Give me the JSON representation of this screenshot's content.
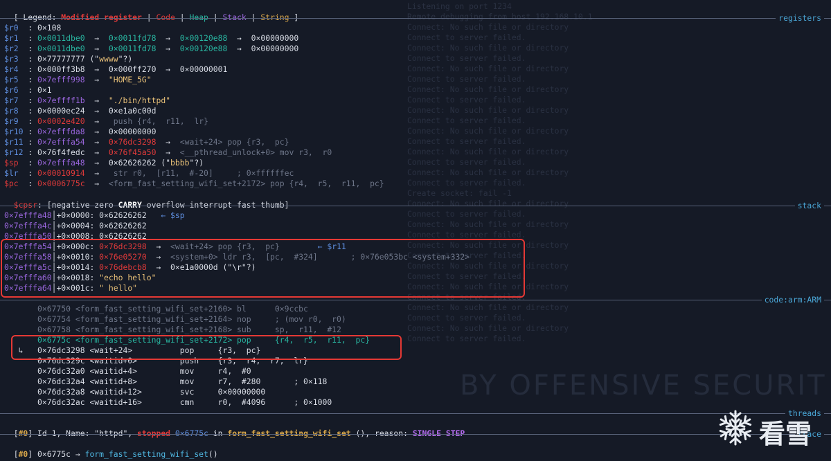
{
  "legend": {
    "prefix": "[ Legend: ",
    "modified": "Modified register",
    "sep1": " | ",
    "code": "Code",
    "sep2": " | ",
    "heap": "Heap",
    "sep3": " | ",
    "stack": "Stack",
    "sep4": " | ",
    "string": "String",
    "suffix": " ]"
  },
  "sections": {
    "registers": "registers",
    "stack": "stack",
    "code": "code:arm:ARM",
    "threads": "threads",
    "trace": "trace"
  },
  "registers": [
    {
      "name": "$r0  ",
      "colon": ": ",
      "v1": "0×108",
      "c1": "wht",
      "rest": []
    },
    {
      "name": "$r1  ",
      "colon": ": ",
      "v1": "0×0011dbe0",
      "c1": "grn",
      "rest": [
        {
          "t": "  →  ",
          "c": "wht"
        },
        {
          "t": "0×0011fd78",
          "c": "grn"
        },
        {
          "t": "  →  ",
          "c": "wht"
        },
        {
          "t": "0×00120e88",
          "c": "grn"
        },
        {
          "t": "  →  ",
          "c": "wht"
        },
        {
          "t": "0×00000000",
          "c": "wht"
        }
      ]
    },
    {
      "name": "$r2  ",
      "colon": ": ",
      "v1": "0×0011dbe0",
      "c1": "grn",
      "rest": [
        {
          "t": "  →  ",
          "c": "wht"
        },
        {
          "t": "0×0011fd78",
          "c": "grn"
        },
        {
          "t": "  →  ",
          "c": "wht"
        },
        {
          "t": "0×00120e88",
          "c": "grn"
        },
        {
          "t": "  →  ",
          "c": "wht"
        },
        {
          "t": "0×00000000",
          "c": "wht"
        }
      ]
    },
    {
      "name": "$r3  ",
      "colon": ": ",
      "v1": "0×77777777",
      "c1": "wht",
      "rest": [
        {
          "t": " (\"",
          "c": "wht"
        },
        {
          "t": "wwww",
          "c": "yel"
        },
        {
          "t": "\"?)",
          "c": "wht"
        }
      ]
    },
    {
      "name": "$r4  ",
      "colon": ": ",
      "v1": "0×000ff3b8",
      "c1": "wht",
      "rest": [
        {
          "t": "  →  ",
          "c": "wht"
        },
        {
          "t": "0×000ff270",
          "c": "wht"
        },
        {
          "t": "  →  ",
          "c": "wht"
        },
        {
          "t": "0×00000001",
          "c": "wht"
        }
      ]
    },
    {
      "name": "$r5  ",
      "colon": ": ",
      "v1": "0×7efff998",
      "c1": "pur",
      "rest": [
        {
          "t": "  →  ",
          "c": "wht"
        },
        {
          "t": "\"HOME_5G\"",
          "c": "yel"
        }
      ]
    },
    {
      "name": "$r6  ",
      "colon": ": ",
      "v1": "0×1",
      "c1": "wht",
      "rest": []
    },
    {
      "name": "$r7  ",
      "colon": ": ",
      "v1": "0×7effff1b",
      "c1": "pur",
      "rest": [
        {
          "t": "  →  ",
          "c": "wht"
        },
        {
          "t": "\"./bin/httpd\"",
          "c": "yel"
        }
      ]
    },
    {
      "name": "$r8  ",
      "colon": ": ",
      "v1": "0×0000ec24",
      "c1": "wht",
      "rest": [
        {
          "t": "  →  ",
          "c": "wht"
        },
        {
          "t": "0×e1a0c00d",
          "c": "wht"
        }
      ]
    },
    {
      "name": "$r9  ",
      "colon": ": ",
      "v1": "0×0002e420",
      "c1": "red",
      "rest": [
        {
          "t": "  →   ",
          "c": "wht"
        },
        {
          "t": "push {r4,  r11,  lr}",
          "c": "dim"
        }
      ]
    },
    {
      "name": "$r10 ",
      "colon": ": ",
      "v1": "0×7efffda8",
      "c1": "pur",
      "rest": [
        {
          "t": "  →  ",
          "c": "wht"
        },
        {
          "t": "0×00000000",
          "c": "wht"
        }
      ]
    },
    {
      "name": "$r11 ",
      "colon": ": ",
      "v1": "0×7efffa54",
      "c1": "pur",
      "rest": [
        {
          "t": "  →  ",
          "c": "wht"
        },
        {
          "t": "0×76dc3298",
          "c": "red"
        },
        {
          "t": "  →  ",
          "c": "wht"
        },
        {
          "t": "<wait+24> pop {r3,  pc}",
          "c": "dim"
        }
      ]
    },
    {
      "name": "$r12 ",
      "colon": ": ",
      "v1": "0×76f4fedc",
      "c1": "wht",
      "rest": [
        {
          "t": "  →  ",
          "c": "wht"
        },
        {
          "t": "0×76f45a50",
          "c": "red"
        },
        {
          "t": "  →  ",
          "c": "wht"
        },
        {
          "t": "<__pthread_unlock+0> mov r3,  r0",
          "c": "dim"
        }
      ]
    },
    {
      "name": "$sp  ",
      "colon": ": ",
      "v1": "0×7efffa48",
      "c1": "pur",
      "rest": [
        {
          "t": "  →  ",
          "c": "wht"
        },
        {
          "t": "0×62626262 (\"",
          "c": "wht"
        },
        {
          "t": "bbbb",
          "c": "yel"
        },
        {
          "t": "\"?)",
          "c": "wht"
        }
      ],
      "mod": true
    },
    {
      "name": "$lr  ",
      "colon": ": ",
      "v1": "0×00010914",
      "c1": "red",
      "rest": [
        {
          "t": "  →   ",
          "c": "wht"
        },
        {
          "t": "str r0,  [r11,  #-20]     ; 0×ffffffec",
          "c": "dim"
        }
      ]
    },
    {
      "name": "$pc  ",
      "colon": ": ",
      "v1": "0×0006775c",
      "c1": "red",
      "rest": [
        {
          "t": "  →  ",
          "c": "wht"
        },
        {
          "t": "<form_fast_setting_wifi_set+2172> pop {r4,  r5,  r11,  pc}",
          "c": "dim"
        }
      ],
      "mod": true
    }
  ],
  "cpsr": {
    "name": "$cpsr",
    "pre": ": [negative zero ",
    "carry": "CARRY",
    "post": " overflow interrupt fast thumb]"
  },
  "stack": [
    {
      "addr": "0×7efffa48",
      "off": "+0×0000: ",
      "val": "0×62626262",
      "vc": "wht",
      "extra": [
        {
          "t": "   ← $sp",
          "c": "blu"
        }
      ]
    },
    {
      "addr": "0×7efffa4c",
      "off": "+0×0004: ",
      "val": "0×62626262",
      "vc": "wht",
      "extra": []
    },
    {
      "addr": "0×7efffa50",
      "off": "+0×0008: ",
      "val": "0×62626262",
      "vc": "wht",
      "extra": []
    },
    {
      "addr": "0×7efffa54",
      "off": "+0×000c: ",
      "val": "0×76dc3298",
      "vc": "red",
      "extra": [
        {
          "t": "  →  ",
          "c": "wht"
        },
        {
          "t": "<wait+24> pop {r3,  pc}",
          "c": "dim"
        },
        {
          "t": "        ← $r11",
          "c": "blu"
        }
      ]
    },
    {
      "addr": "0×7efffa58",
      "off": "+0×0010: ",
      "val": "0×76e05270",
      "vc": "red",
      "extra": [
        {
          "t": "  →  ",
          "c": "wht"
        },
        {
          "t": "<system+0> ldr r3,  [pc,  #324]       ; 0×76e053bc <system+332>",
          "c": "dim"
        }
      ]
    },
    {
      "addr": "0×7efffa5c",
      "off": "+0×0014: ",
      "val": "0×76debcb8",
      "vc": "red",
      "extra": [
        {
          "t": "  →  ",
          "c": "wht"
        },
        {
          "t": "0×e1a0000d (\"\\r\"?)",
          "c": "wht"
        }
      ]
    },
    {
      "addr": "0×7efffa60",
      "off": "+0×0018: ",
      "val": "\"echo hello\"",
      "vc": "yel",
      "extra": []
    },
    {
      "addr": "0×7efffa64",
      "off": "+0×001c: ",
      "val": "\" hello\"",
      "vc": "yel",
      "extra": []
    }
  ],
  "code": [
    {
      "t": "       0×67750 <form_fast_setting_wifi_set+2160> bl      0×9ccbc",
      "c": "dim"
    },
    {
      "t": "       0×67754 <form_fast_setting_wifi_set+2164> nop     ; (mov r0,  r0)",
      "c": "dim"
    },
    {
      "t": "       0×67758 <form_fast_setting_wifi_set+2168> sub     sp,  r11,  #12",
      "c": "dim"
    },
    {
      "t": "       0×6775c <form_fast_setting_wifi_set+2172> pop     {r4,  r5,  r11,  pc}",
      "c": "grn"
    },
    {
      "t": "   ↳   0×76dc3298 <wait+24>          pop     {r3,  pc}",
      "c": "wht"
    },
    {
      "t": "       0×76dc329c <waitid+0>         push    {r3,  r4,  r7,  lr}",
      "c": "wht"
    },
    {
      "t": "       0×76dc32a0 <waitid+4>         mov     r4,  #0",
      "c": "wht"
    },
    {
      "t": "       0×76dc32a4 <waitid+8>         mov     r7,  #280       ; 0×118",
      "c": "wht"
    },
    {
      "t": "       0×76dc32a8 <waitid+12>        svc     0×00000000",
      "c": "wht"
    },
    {
      "t": "       0×76dc32ac <waitid+16>        cmn     r0,  #4096      ; 0×1000",
      "c": "wht"
    }
  ],
  "thread": {
    "p1": "[",
    "id": "#0",
    "p2": "] Id 1, Name: \"httpd\", ",
    "stopped": "stopped",
    "p3": " ",
    "addr": "0×6775c",
    "p4": " in ",
    "func": "form_fast_setting_wifi_set",
    "p5": " (), reason: ",
    "reason": "SINGLE STEP"
  },
  "trace": {
    "p1": "[",
    "id": "#0",
    "p2": "] 0×6775c → ",
    "func": "form_fast_setting_wifi_set",
    "p3": "()"
  },
  "background_lines": [
    "Listening on port 1234",
    "Remote debugging from host 192.168.10.1",
    "Connect: No such file or directory",
    "Connect to server failed.",
    "Connect: No such file or directory",
    "Connect to server failed.",
    "Connect: No such file or directory",
    "Connect to server failed.",
    "Connect: No such file or directory",
    "Connect to server failed.",
    "Connect: No such file or directory",
    "Connect to server failed.",
    "Connect: No such file or directory",
    "Connect to server failed.",
    "Connect: No such file or directory",
    "Connect to server failed.",
    "Connect: No such file or directory",
    "Connect to server failed.",
    "Create socket: fail -1",
    "Connect: No such file or directory",
    "Connect to server failed.",
    "Connect: No such file or directory",
    "Connect to server failed.",
    "Connect: No such file or directory",
    "Connect to server failed.",
    "Connect: No such file or directory",
    "Connect to server failed.",
    "Connect: No such file or directory",
    "Connect to server failed.",
    "Connect: No such file or directory",
    "Connect to server failed.",
    "Connect: No such file or directory",
    "Connect to server failed."
  ],
  "watermark": "BY OFFENSIVE SECURIT",
  "logo_text": "看雪"
}
